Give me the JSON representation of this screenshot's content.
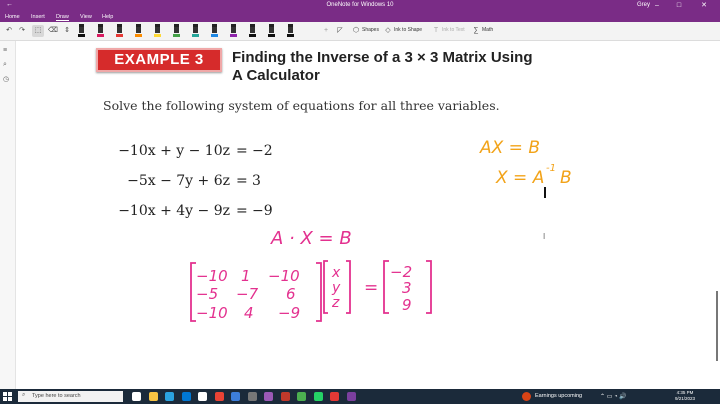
{
  "window": {
    "title": "OneNote for Windows 10",
    "user": "Grey",
    "minimize": "–",
    "maximize": "□",
    "close": "✕",
    "back_glyph": "←"
  },
  "menu": {
    "items": [
      "Home",
      "Insert",
      "Draw",
      "View",
      "Help"
    ],
    "active": "Draw"
  },
  "ribbon": {
    "undo": "↶",
    "redo": "↷",
    "shapes_label": "Shapes",
    "ink_to_shape_label": "Ink to Shape",
    "ink_to_text_label": "Ink to Text",
    "math_label": "Math",
    "pen_colors": [
      "#111111",
      "#d81b60",
      "#e53935",
      "#fb8c00",
      "#fdd835",
      "#43a047",
      "#26a69a",
      "#1e88e5",
      "#8e24aa",
      "#111111",
      "#111111",
      "#111111"
    ]
  },
  "page": {
    "badge": "EXAMPLE 3",
    "heading_line1": "Finding the Inverse of a 3 × 3 Matrix Using",
    "heading_line2": "A Calculator",
    "instruction": "Solve the following system of equations for all three variables.",
    "equations": [
      {
        "lhs": "−10x + y − 10z",
        "op": "=",
        "rhs": "−2"
      },
      {
        "lhs": "−5x − 7y + 6z",
        "op": "=",
        "rhs": "3"
      },
      {
        "lhs": "−10x + 4y − 9z",
        "op": "=",
        "rhs": "−9"
      }
    ]
  },
  "ink": {
    "pink_color": "#e3318f",
    "orange_color": "#f2a319",
    "ax_eq_b": "AX = B",
    "x_eq_ainv_b_a": "X = A",
    "x_eq_ainv_b_sup": "-1",
    "x_eq_ainv_b_b": "B",
    "a_dot_x_eq_b": "A · X = B",
    "matrix_a": [
      [
        "−10",
        "1",
        "−10"
      ],
      [
        "−5",
        "−7",
        "6"
      ],
      [
        "−10",
        "4",
        "−9"
      ]
    ],
    "vector_x": [
      "x",
      "y",
      "z"
    ],
    "equals": "=",
    "vector_b": [
      "−2",
      "3",
      "9"
    ]
  },
  "taskbar": {
    "search_placeholder": "Type here to search",
    "news": "Earnings upcoming",
    "time": "4:35 PM",
    "date": "9/21/2023",
    "icon_colors": [
      "#ffffff",
      "#f6c343",
      "#2ba3e0",
      "#0078d4",
      "#ffffff",
      "#e94335",
      "#3d7eda",
      "#777777",
      "#9b59b6",
      "#c0392b",
      "#4caf50",
      "#25d366",
      "#e53935",
      "#7b3f9e"
    ]
  }
}
